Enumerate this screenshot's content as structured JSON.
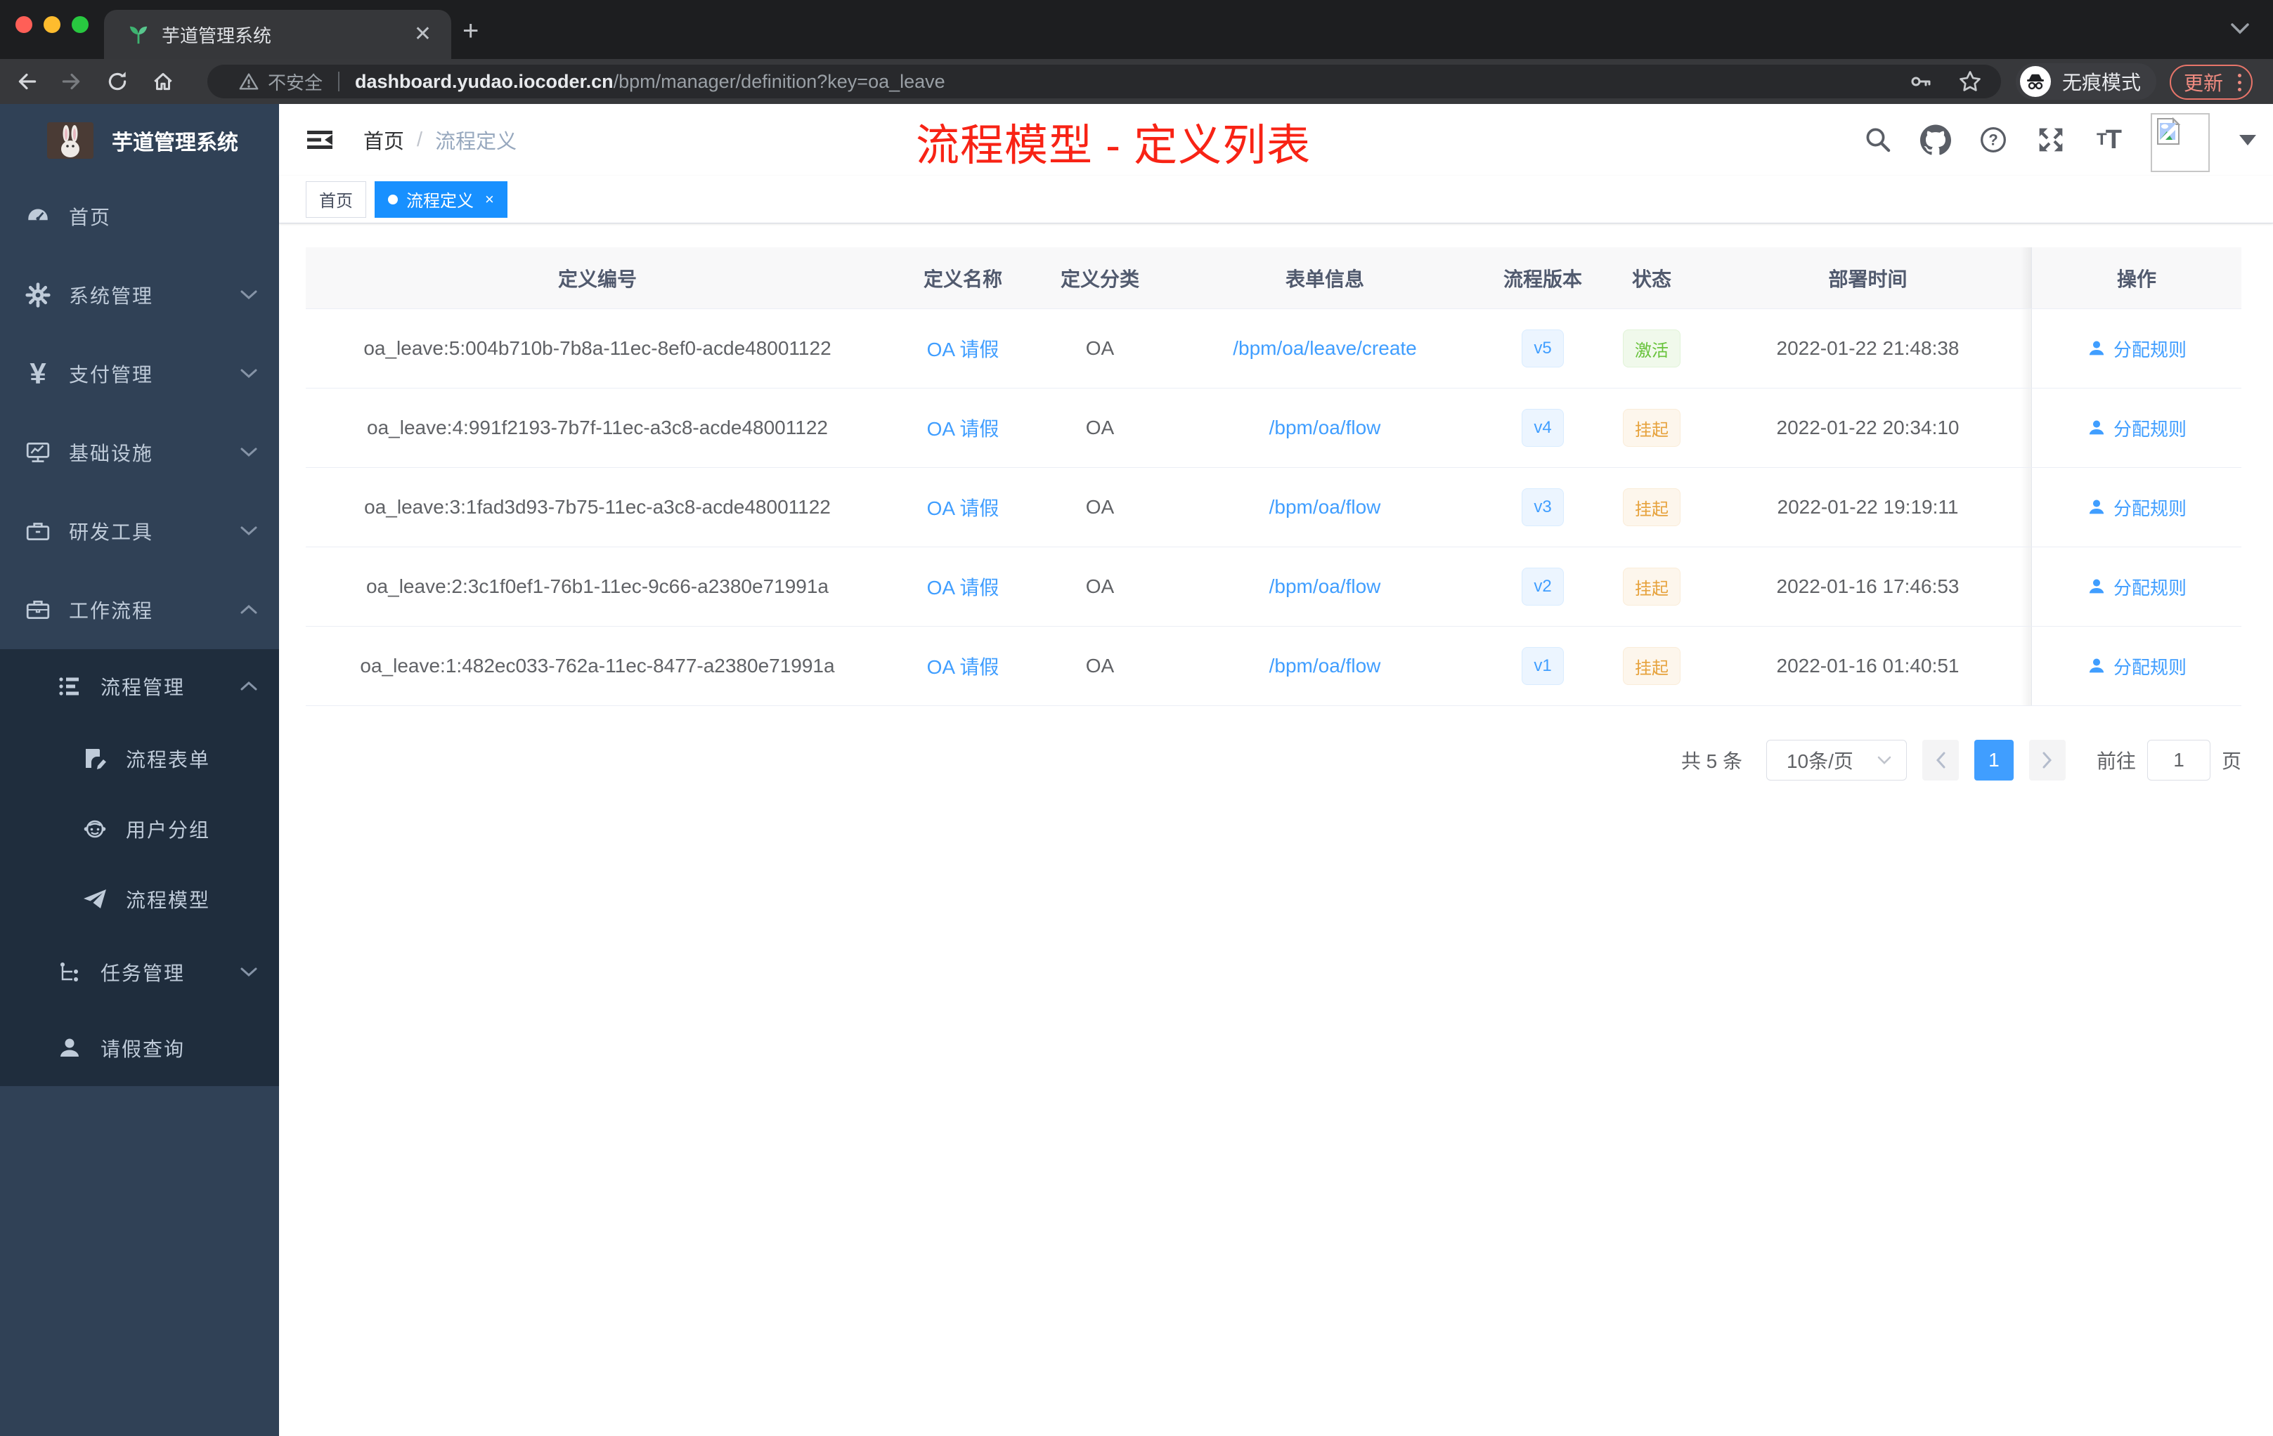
{
  "browser": {
    "tab_title": "芋道管理系统",
    "url": {
      "security_label": "不安全",
      "host": "dashboard.yudao.iocoder.cn",
      "path": "/bpm/manager/definition?key=oa_leave"
    },
    "incognito_label": "无痕模式",
    "update_label": "更新"
  },
  "sidebar": {
    "logo_title": "芋道管理系统",
    "menu": [
      {
        "label": "首页",
        "icon": "dashboard-icon",
        "state": "none"
      },
      {
        "label": "系统管理",
        "icon": "gear-icon",
        "state": "collapsed"
      },
      {
        "label": "支付管理",
        "icon": "yen-icon",
        "state": "collapsed"
      },
      {
        "label": "基础设施",
        "icon": "monitor-icon",
        "state": "collapsed"
      },
      {
        "label": "研发工具",
        "icon": "toolbox-icon",
        "state": "collapsed"
      },
      {
        "label": "工作流程",
        "icon": "briefcase-icon",
        "state": "expanded"
      }
    ],
    "submenu": [
      {
        "label": "流程管理",
        "icon": "tree-table-icon",
        "state": "expanded"
      },
      {
        "label": "流程表单",
        "icon": "form-icon"
      },
      {
        "label": "用户分组",
        "icon": "user-group-icon"
      },
      {
        "label": "流程模型",
        "icon": "paper-plane-icon"
      },
      {
        "label": "任务管理",
        "icon": "tree-icon",
        "state": "collapsed"
      },
      {
        "label": "请假查询",
        "icon": "user-icon"
      }
    ]
  },
  "header": {
    "breadcrumb": {
      "home": "首页",
      "separator": "/",
      "current": "流程定义"
    },
    "annotation": "流程模型 - 定义列表",
    "font_icon_text": {
      "small": "T",
      "big": "T"
    }
  },
  "tags": [
    {
      "label": "首页",
      "active": false
    },
    {
      "label": "流程定义",
      "active": true,
      "close": "×"
    }
  ],
  "table": {
    "columns": [
      "定义编号",
      "定义名称",
      "定义分类",
      "表单信息",
      "流程版本",
      "状态",
      "部署时间",
      "操作"
    ],
    "rows": [
      {
        "id": "oa_leave:5:004b710b-7b8a-11ec-8ef0-acde48001122",
        "name": "OA 请假",
        "category": "OA",
        "form": "/bpm/oa/leave/create",
        "version": "v5",
        "status": "激活",
        "status_type": "success",
        "deploy_time": "2022-01-22 21:48:38",
        "action": "分配规则"
      },
      {
        "id": "oa_leave:4:991f2193-7b7f-11ec-a3c8-acde48001122",
        "name": "OA 请假",
        "category": "OA",
        "form": "/bpm/oa/flow",
        "version": "v4",
        "status": "挂起",
        "status_type": "warning",
        "deploy_time": "2022-01-22 20:34:10",
        "action": "分配规则"
      },
      {
        "id": "oa_leave:3:1fad3d93-7b75-11ec-a3c8-acde48001122",
        "name": "OA 请假",
        "category": "OA",
        "form": "/bpm/oa/flow",
        "version": "v3",
        "status": "挂起",
        "status_type": "warning",
        "deploy_time": "2022-01-22 19:19:11",
        "action": "分配规则"
      },
      {
        "id": "oa_leave:2:3c1f0ef1-76b1-11ec-9c66-a2380e71991a",
        "name": "OA 请假",
        "category": "OA",
        "form": "/bpm/oa/flow",
        "version": "v2",
        "status": "挂起",
        "status_type": "warning",
        "deploy_time": "2022-01-16 17:46:53",
        "action": "分配规则"
      },
      {
        "id": "oa_leave:1:482ec033-762a-11ec-8477-a2380e71991a",
        "name": "OA 请假",
        "category": "OA",
        "form": "/bpm/oa/flow",
        "version": "v1",
        "status": "挂起",
        "status_type": "warning",
        "deploy_time": "2022-01-16 01:40:51",
        "action": "分配规则"
      }
    ]
  },
  "pagination": {
    "total": "共 5 条",
    "page_size": "10条/页",
    "page": "1",
    "goto_label": "前往",
    "goto_value": "1",
    "goto_suffix": "页"
  },
  "colors": {
    "accent": "#409eff",
    "tag_active": "#1890ff",
    "annotation_red": "#f82315",
    "status_active": "#67c23a",
    "status_suspended": "#e6a23c",
    "sidebar_bg": "#304156",
    "submenu_bg": "#1f2d3d"
  }
}
